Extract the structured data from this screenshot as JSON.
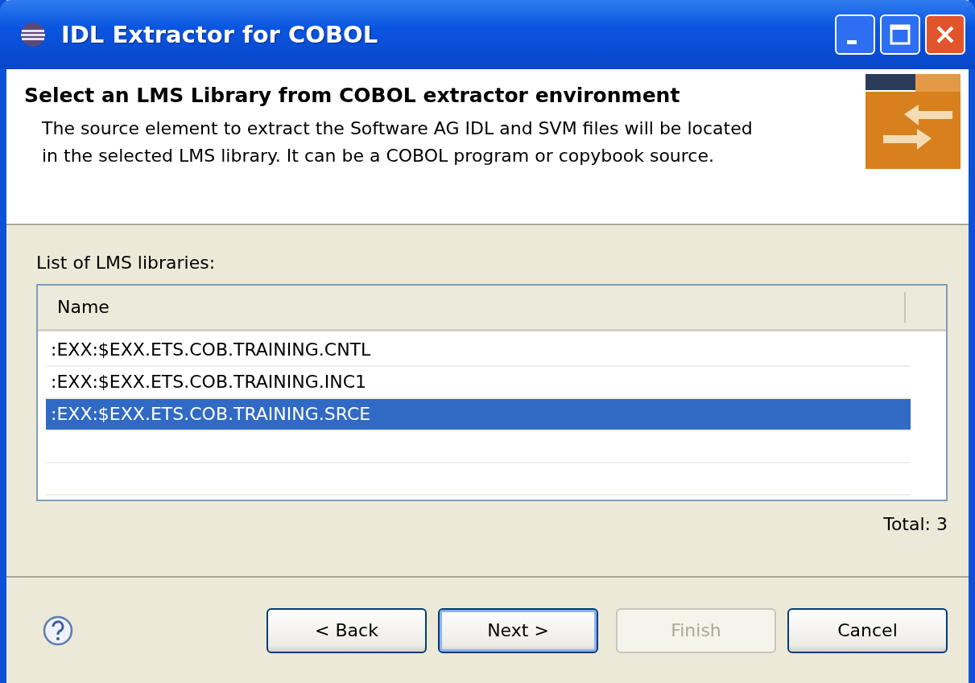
{
  "window": {
    "title": "IDL Extractor for COBOL"
  },
  "header": {
    "title": "Select an LMS Library from COBOL extractor environment",
    "description": "The source element to extract the Software AG IDL and SVM files will be located in the selected LMS library. It can be a COBOL program or copybook source."
  },
  "list_label": "List of LMS libraries:",
  "table": {
    "columns": [
      "Name"
    ],
    "rows": [
      {
        "name": ":EXX:$EXX.ETS.COB.TRAINING.CNTL",
        "selected": false
      },
      {
        "name": ":EXX:$EXX.ETS.COB.TRAINING.INC1",
        "selected": false
      },
      {
        "name": ":EXX:$EXX.ETS.COB.TRAINING.SRCE",
        "selected": true
      }
    ]
  },
  "total": "Total: 3",
  "buttons": [
    {
      "label": "< Back",
      "disabled": false,
      "default": false
    },
    {
      "label": "Next >",
      "disabled": false,
      "default": true
    },
    {
      "label": "Finish",
      "disabled": true,
      "default": false
    },
    {
      "label": "Cancel",
      "disabled": false,
      "default": false
    }
  ]
}
